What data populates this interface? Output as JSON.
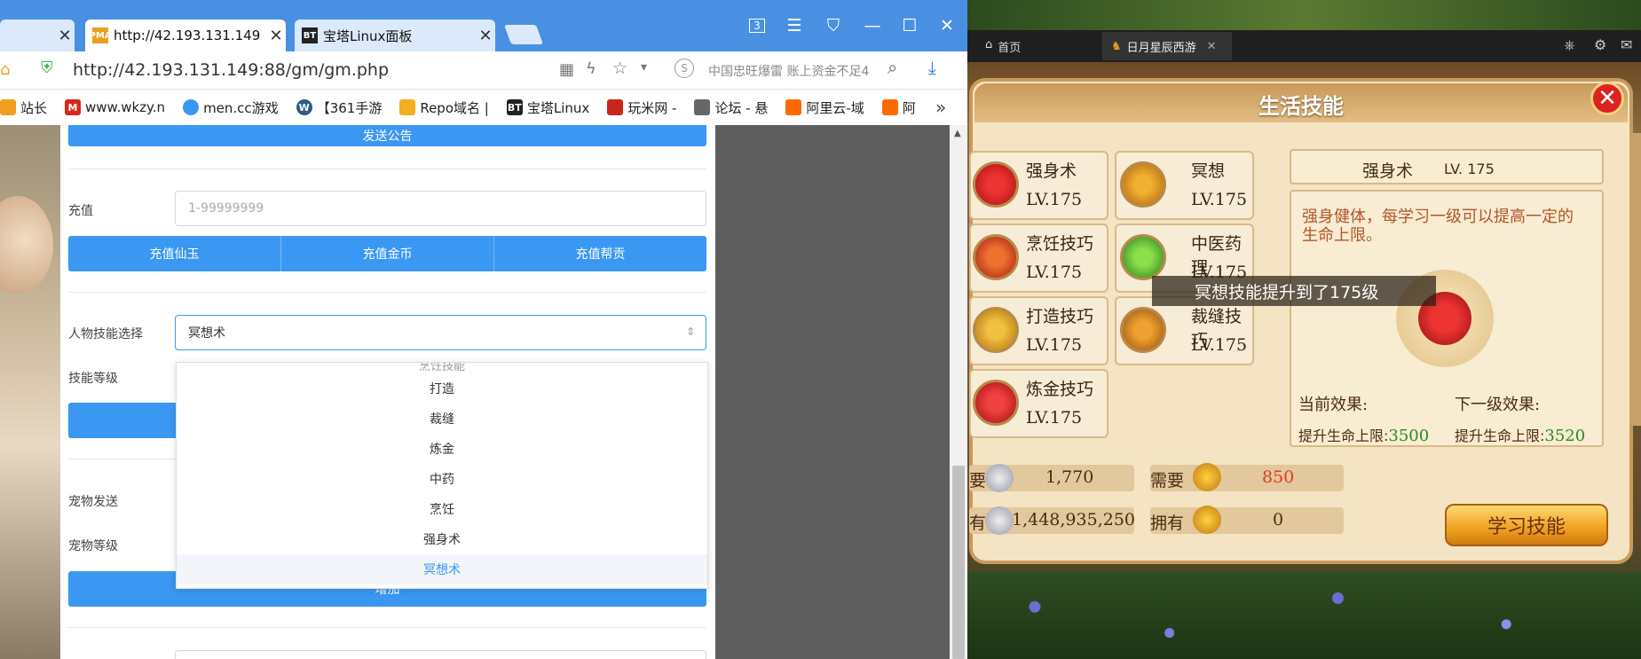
{
  "browser": {
    "tabs": [
      {
        "label": "",
        "close": "✕"
      },
      {
        "label": "http://42.193.131.149",
        "close": "✕",
        "favicon": "PMA"
      },
      {
        "label": "宝塔Linux面板",
        "close": "✕",
        "favicon": "BT"
      }
    ],
    "window_controls": {
      "badge": "3"
    },
    "url": "http://42.193.131.149:88/gm/gm.php",
    "search_placeholder": "中国忠旺爆雷 账上资金不足4",
    "bookmarks": [
      "站长",
      "www.wkzy.n",
      "men.cc游戏",
      "【361手游",
      "Repo域名 |",
      "宝塔Linux",
      "玩米网 -",
      "论坛 - 悬",
      "阿里云-域",
      "阿"
    ],
    "bookmarks_more": "»"
  },
  "form": {
    "announce_button": "发送公告",
    "recharge_label": "充值",
    "recharge_placeholder": "1-99999999",
    "recharge_buttons": [
      "充值仙玉",
      "充值金币",
      "充值帮贡"
    ],
    "skill_select_label": "人物技能选择",
    "skill_select_value": "冥想术",
    "skill_level_label": "技能等级",
    "pet_send_label": "宠物发送",
    "pet_level_label": "宠物等级",
    "add_button": "增加",
    "dropdown_partial": "烹饪技能",
    "dropdown_options": [
      "打造",
      "裁缝",
      "炼金",
      "中药",
      "烹饪",
      "强身术",
      "冥想术"
    ],
    "dropdown_selected": "冥想术"
  },
  "game": {
    "tabs": [
      "首页",
      "日月星辰西游"
    ],
    "panel_title": "生活技能",
    "skills": [
      {
        "name": "强身术",
        "level": "LV.175"
      },
      {
        "name": "冥想",
        "level": "LV.175"
      },
      {
        "name": "烹饪技巧",
        "level": "LV.175"
      },
      {
        "name": "中医药理",
        "level": "LV.175"
      },
      {
        "name": "打造技巧",
        "level": "LV.175"
      },
      {
        "name": "裁缝技巧",
        "level": "LV.175"
      },
      {
        "name": "炼金技巧",
        "level": "LV.175"
      }
    ],
    "toast": "冥想技能提升到了175级",
    "detail": {
      "name": "强身术",
      "level": "LV. 175",
      "description": "强身健体，每学习一级可以提高一定的生命上限。",
      "current_effect_label": "当前效果:",
      "next_effect_label": "下一级效果:",
      "current_effect_text": "提升生命上限:",
      "current_effect_value": "3500",
      "next_effect_text": "提升生命上限:",
      "next_effect_value": "3520"
    },
    "cost": {
      "need_label_left": "要",
      "need_silver": "1,770",
      "have_label_left": "有",
      "have_silver": "1,448,935,250",
      "need_label": "需要",
      "need_gold": "850",
      "have_label": "拥有",
      "have_gold": "0"
    },
    "learn_button": "学习技能",
    "colors": {
      "need_gold": "#e03a2a",
      "effect_value": "#2a8a2a"
    }
  }
}
